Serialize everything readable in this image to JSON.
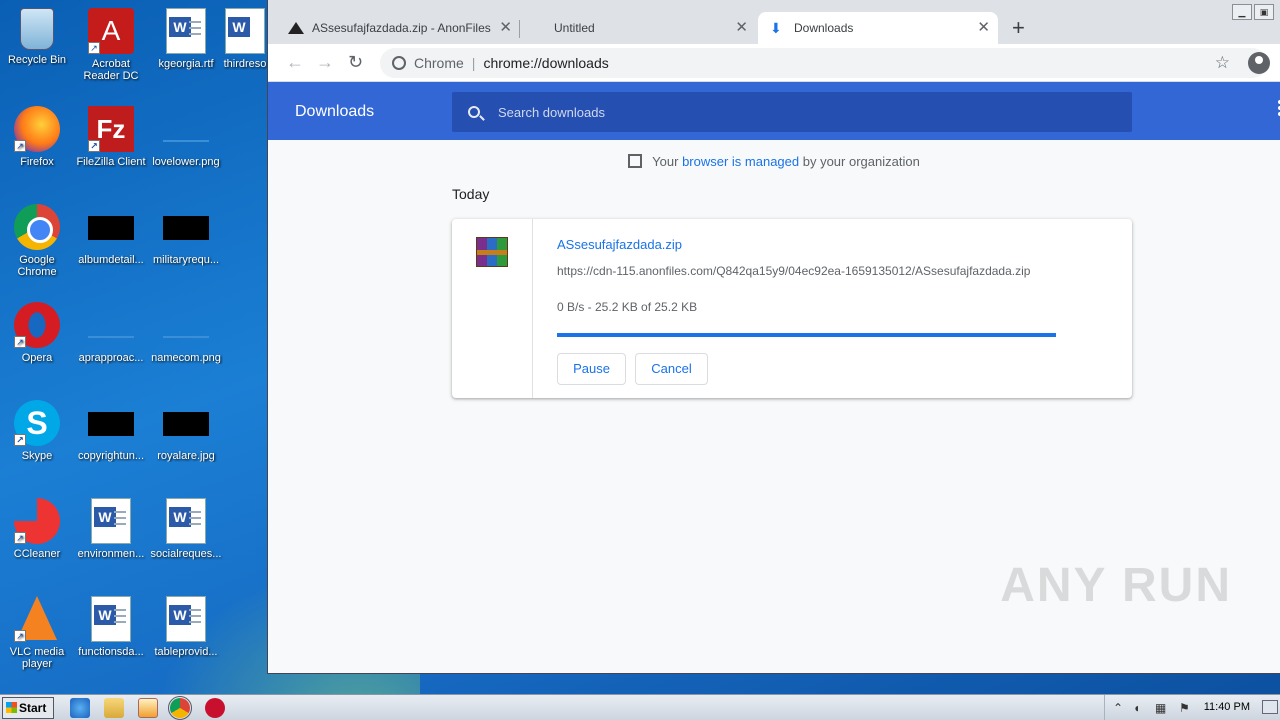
{
  "desktop": {
    "icons": [
      {
        "label": "Recycle Bin",
        "icon": "recycle-bin-icon"
      },
      {
        "label": "Acrobat Reader DC",
        "icon": "acrobat-icon"
      },
      {
        "label": "kgeorgia.rtf",
        "icon": "word-doc-icon"
      },
      {
        "label": "thirdreso",
        "icon": "word-doc-icon"
      },
      {
        "label": "Firefox",
        "icon": "firefox-icon"
      },
      {
        "label": "FileZilla Client",
        "icon": "filezilla-icon"
      },
      {
        "label": "lovelower.png",
        "icon": "image-file-icon"
      },
      {
        "label": "Google Chrome",
        "icon": "chrome-icon"
      },
      {
        "label": "albumdetail...",
        "icon": "image-file-icon"
      },
      {
        "label": "militaryrequ...",
        "icon": "image-file-icon"
      },
      {
        "label": "Opera",
        "icon": "opera-icon"
      },
      {
        "label": "aprapproac...",
        "icon": "image-file-icon"
      },
      {
        "label": "namecom.png",
        "icon": "image-file-icon"
      },
      {
        "label": "Skype",
        "icon": "skype-icon"
      },
      {
        "label": "copyrightun...",
        "icon": "image-file-icon"
      },
      {
        "label": "royalare.jpg",
        "icon": "image-file-icon"
      },
      {
        "label": "CCleaner",
        "icon": "ccleaner-icon"
      },
      {
        "label": "environmen...",
        "icon": "word-doc-icon"
      },
      {
        "label": "socialreques...",
        "icon": "word-doc-icon"
      },
      {
        "label": "VLC media player",
        "icon": "vlc-icon"
      },
      {
        "label": "functionsda...",
        "icon": "word-doc-icon"
      },
      {
        "label": "tableprovid...",
        "icon": "word-doc-icon"
      }
    ]
  },
  "browser": {
    "tabs": [
      {
        "title": "ASsesufajfazdada.zip - AnonFiles",
        "favicon": "anonfiles-icon",
        "active": false
      },
      {
        "title": "Untitled",
        "favicon": "",
        "active": false
      },
      {
        "title": "Downloads",
        "favicon": "download-icon",
        "active": true
      }
    ],
    "omnibox": {
      "scheme": "Chrome",
      "url": "chrome://downloads"
    }
  },
  "downloads_page": {
    "header_title": "Downloads",
    "search_placeholder": "Search downloads",
    "managed": {
      "prefix": "Your ",
      "link": "browser is managed",
      "suffix": " by your organization"
    },
    "section": "Today",
    "item": {
      "file_name": "ASsesufajfazdada.zip",
      "url": "https://cdn-115.anonfiles.com/Q842qa15y9/04ec92ea-1659135012/ASsesufajfazdada.zip",
      "status": "0 B/s - 25.2 KB of 25.2 KB",
      "progress_percent": 100,
      "pause_label": "Pause",
      "cancel_label": "Cancel"
    }
  },
  "watermark": "ANY RUN",
  "taskbar": {
    "start_label": "Start",
    "clock": "11:40 PM"
  }
}
